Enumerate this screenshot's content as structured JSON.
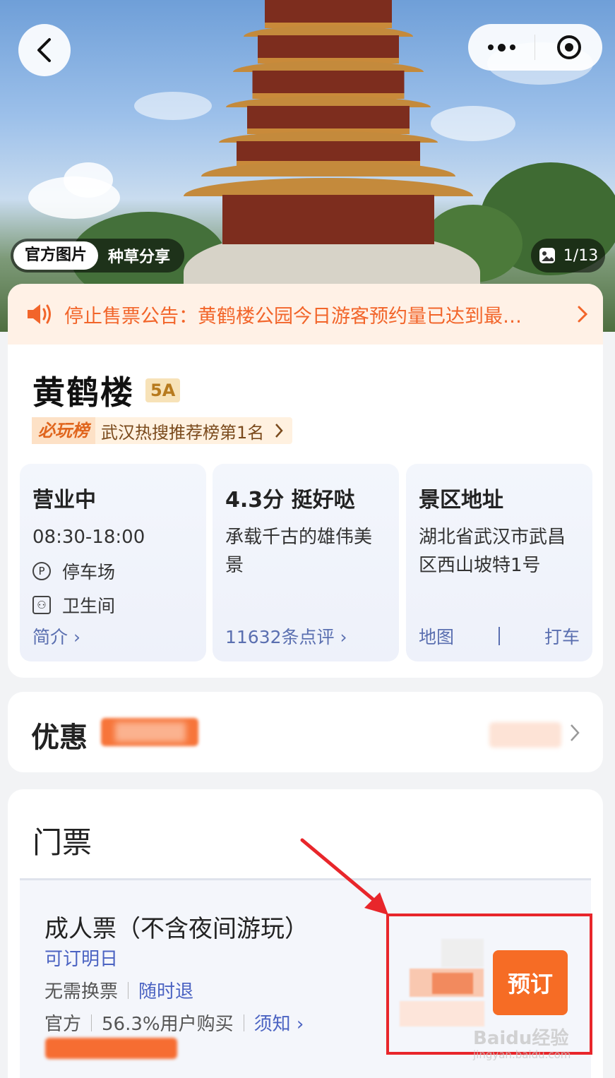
{
  "hero": {
    "photo_tabs": [
      "官方图片",
      "种草分享"
    ],
    "counter": "1/13"
  },
  "notice": {
    "text": "停止售票公告：黄鹤楼公园今日游客预约量已达到最…"
  },
  "attraction": {
    "name": "黄鹤楼",
    "level": "5A",
    "rank_tag": "必玩榜",
    "rank_text": "武汉热搜推荐榜第1名"
  },
  "tiles": {
    "hours": {
      "status": "营业中",
      "time": "08:30-18:00",
      "facility_1": "停车场",
      "facility_2": "卫生间",
      "link": "简介"
    },
    "rating": {
      "score": "4.3分 挺好哒",
      "desc": "承载千古的雄伟美景",
      "link": "11632条点评"
    },
    "address": {
      "heading": "景区地址",
      "text": "湖北省武汉市武昌区西山坡特1号",
      "map": "地图",
      "taxi": "打车"
    }
  },
  "discount": {
    "title": "优惠"
  },
  "ticket": {
    "section_title": "门票",
    "name": "成人票（不含夜间游玩）",
    "availability": "可订明日",
    "tag_1": "无需换票",
    "tag_2": "随时退",
    "source": "官方",
    "purchase_ratio": "56.3%用户购买",
    "notes": "须知",
    "book_label": "预订"
  },
  "watermark": {
    "brand": "Baidu经验",
    "url": "jingyan.baidu.com"
  },
  "colors": {
    "accent": "#f66c25",
    "link_blue": "#4b63c2",
    "highlight_frame": "#e8262b"
  }
}
